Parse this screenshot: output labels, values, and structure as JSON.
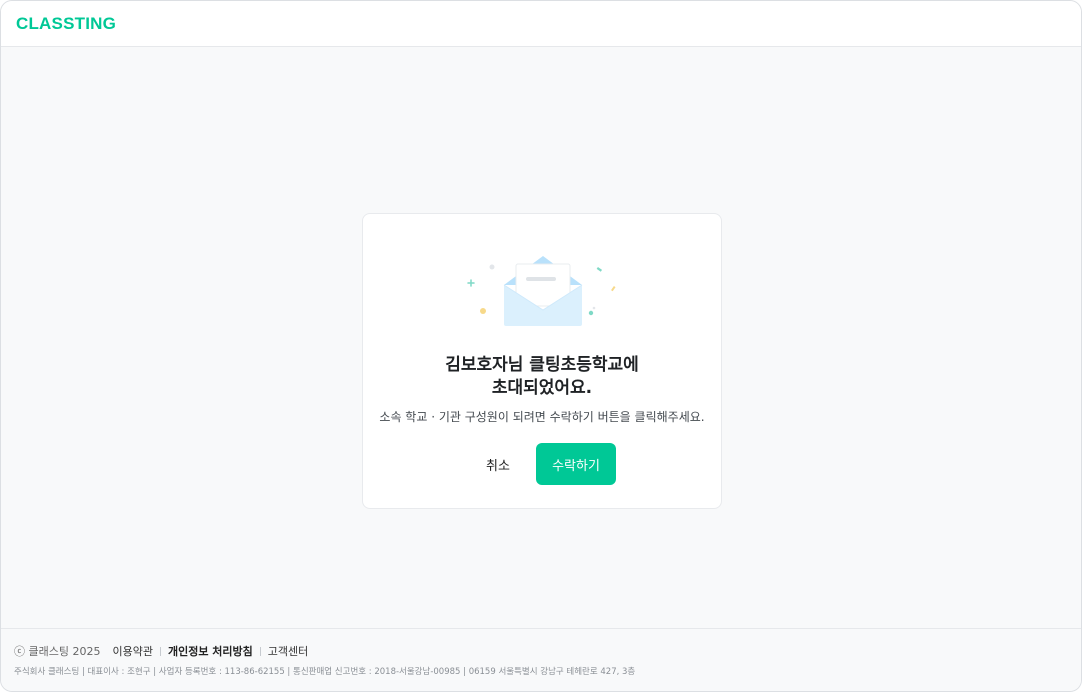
{
  "header": {
    "logo": "CLASSTING"
  },
  "invite": {
    "title_line1": "김보호자님 클팅초등학교에",
    "title_line2": "초대되었어요.",
    "description": "소속 학교 · 기관 구성원이 되려면 수락하기 버튼을 클릭해주세요.",
    "cancel_label": "취소",
    "accept_label": "수락하기"
  },
  "footer": {
    "copyright": "ⓒ 클래스팅 2025",
    "links": [
      "이용약관",
      "개인정보 처리방침",
      "고객센터"
    ],
    "company_info": "주식회사 클래스팅 | 대표이사 : 조현구 | 사업자 등록번호 : 113-86-62155 | 통신판매업 신고번호 : 2018-서울강남-00985 | 06159 서울특별시 강남구 테헤란로 427, 3층"
  },
  "colors": {
    "brand": "#00c896",
    "background": "#f8f9fa"
  },
  "icons": {
    "illustration": "envelope-invitation-icon"
  }
}
